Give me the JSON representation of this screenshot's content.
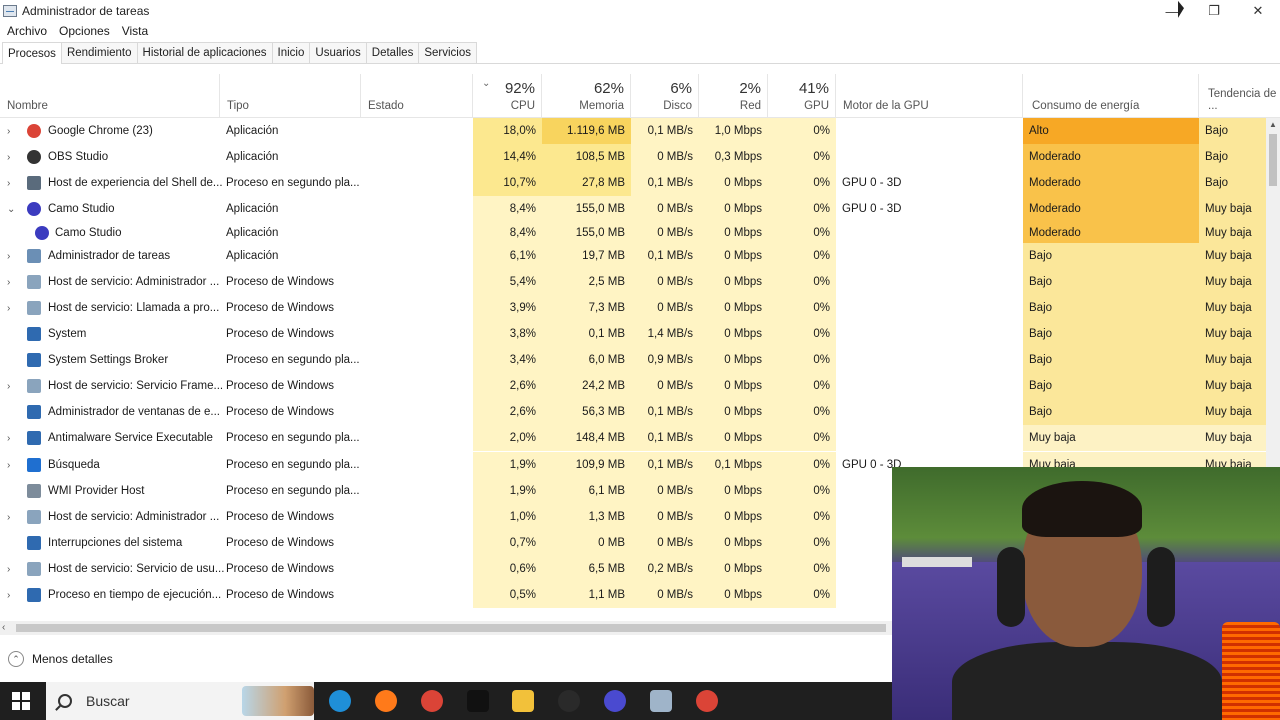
{
  "window": {
    "title": "Administrador de tareas",
    "minimize": "—",
    "restore": "❐",
    "close": "✕"
  },
  "menu": [
    "Archivo",
    "Opciones",
    "Vista"
  ],
  "tabs": [
    "Procesos",
    "Rendimiento",
    "Historial de aplicaciones",
    "Inicio",
    "Usuarios",
    "Detalles",
    "Servicios"
  ],
  "active_tab": "Procesos",
  "header": {
    "nombre": "Nombre",
    "tipo": "Tipo",
    "estado": "Estado",
    "cpu_pct": "92%",
    "cpu": "CPU",
    "mem_pct": "62%",
    "mem": "Memoria",
    "disk_pct": "6%",
    "disk": "Disco",
    "net_pct": "2%",
    "net": "Red",
    "gpu_pct": "41%",
    "gpu": "GPU",
    "gpu_engine": "Motor de la GPU",
    "power": "Consumo de energía",
    "power_trend": "Tendencia de ..."
  },
  "rows": [
    {
      "name": "Google Chrome (23)",
      "type": "Aplicación",
      "cpu": "18,0%",
      "mem": "1.119,6 MB",
      "disk": "0,1 MB/s",
      "net": "1,0 Mbps",
      "gpu": "0%",
      "engine": "",
      "power": "Alto",
      "trend": "Bajo",
      "exp": "›",
      "icon": "chrome-icon",
      "ic": "#db4437",
      "indent": 0,
      "pw": "#f7a825",
      "memhi": true,
      "cpuhi": true
    },
    {
      "name": "OBS Studio",
      "type": "Aplicación",
      "cpu": "14,4%",
      "mem": "108,5 MB",
      "disk": "0 MB/s",
      "net": "0,3 Mbps",
      "gpu": "0%",
      "engine": "",
      "power": "Moderado",
      "trend": "Bajo",
      "exp": "›",
      "icon": "obs-icon",
      "ic": "#333",
      "indent": 0,
      "pw": "#f9c24a",
      "memhi": false,
      "cpuhi": true
    },
    {
      "name": "Host de experiencia del Shell de...",
      "type": "Proceso en segundo pla...",
      "cpu": "10,7%",
      "mem": "27,8 MB",
      "disk": "0,1 MB/s",
      "net": "0 Mbps",
      "gpu": "0%",
      "engine": "GPU 0 - 3D",
      "power": "Moderado",
      "trend": "Bajo",
      "exp": "›",
      "icon": "window-icon",
      "ic": "#5a6b7c",
      "indent": 0,
      "pw": "#f9c24a",
      "memhi": false,
      "cpuhi": true
    },
    {
      "name": "Camo Studio",
      "type": "Aplicación",
      "cpu": "8,4%",
      "mem": "155,0 MB",
      "disk": "0 MB/s",
      "net": "0 Mbps",
      "gpu": "0%",
      "engine": "GPU 0 - 3D",
      "power": "Moderado",
      "trend": "Muy baja",
      "exp": "⌄",
      "icon": "camo-icon",
      "ic": "#3b3bbf",
      "indent": 0,
      "pw": "#f9c24a",
      "memhi": false,
      "cpuhi": false
    },
    {
      "name": "Camo Studio",
      "type": "Aplicación",
      "cpu": "8,4%",
      "mem": "155,0 MB",
      "disk": "0 MB/s",
      "net": "0 Mbps",
      "gpu": "0%",
      "engine": "",
      "power": "Moderado",
      "trend": "Muy baja",
      "exp": "",
      "icon": "camo-icon",
      "ic": "#3b3bbf",
      "indent": 1,
      "pw": "#f9c24a",
      "memhi": false,
      "cpuhi": false
    },
    {
      "name": "Administrador de tareas",
      "type": "Aplicación",
      "cpu": "6,1%",
      "mem": "19,7 MB",
      "disk": "0,1 MB/s",
      "net": "0 Mbps",
      "gpu": "0%",
      "engine": "",
      "power": "Bajo",
      "trend": "Muy baja",
      "exp": "›",
      "icon": "task-manager-icon",
      "ic": "#6b8fb5",
      "indent": 0,
      "pw": "#fbe79a",
      "memhi": false,
      "cpuhi": false
    },
    {
      "name": "Host de servicio: Administrador ...",
      "type": "Proceso de Windows",
      "cpu": "5,4%",
      "mem": "2,5 MB",
      "disk": "0 MB/s",
      "net": "0 Mbps",
      "gpu": "0%",
      "engine": "",
      "power": "Bajo",
      "trend": "Muy baja",
      "exp": "›",
      "icon": "gear-icon",
      "ic": "#8aa4bd",
      "indent": 0,
      "pw": "#fbe79a",
      "memhi": false,
      "cpuhi": false
    },
    {
      "name": "Host de servicio: Llamada a pro...",
      "type": "Proceso de Windows",
      "cpu": "3,9%",
      "mem": "7,3 MB",
      "disk": "0 MB/s",
      "net": "0 Mbps",
      "gpu": "0%",
      "engine": "",
      "power": "Bajo",
      "trend": "Muy baja",
      "exp": "›",
      "icon": "gear-icon",
      "ic": "#8aa4bd",
      "indent": 0,
      "pw": "#fbe79a",
      "memhi": false,
      "cpuhi": false
    },
    {
      "name": "System",
      "type": "Proceso de Windows",
      "cpu": "3,8%",
      "mem": "0,1 MB",
      "disk": "1,4 MB/s",
      "net": "0 Mbps",
      "gpu": "0%",
      "engine": "",
      "power": "Bajo",
      "trend": "Muy baja",
      "exp": "",
      "icon": "window-icon",
      "ic": "#2f6ab0",
      "indent": 0,
      "pw": "#fbe79a",
      "memhi": false,
      "cpuhi": false
    },
    {
      "name": "System Settings Broker",
      "type": "Proceso en segundo pla...",
      "cpu": "3,4%",
      "mem": "6,0 MB",
      "disk": "0,9 MB/s",
      "net": "0 Mbps",
      "gpu": "0%",
      "engine": "",
      "power": "Bajo",
      "trend": "Muy baja",
      "exp": "",
      "icon": "settings-icon",
      "ic": "#2f6ab0",
      "indent": 0,
      "pw": "#fbe79a",
      "memhi": false,
      "cpuhi": false
    },
    {
      "name": "Host de servicio: Servicio Frame...",
      "type": "Proceso de Windows",
      "cpu": "2,6%",
      "mem": "24,2 MB",
      "disk": "0 MB/s",
      "net": "0 Mbps",
      "gpu": "0%",
      "engine": "",
      "power": "Bajo",
      "trend": "Muy baja",
      "exp": "›",
      "icon": "gear-icon",
      "ic": "#8aa4bd",
      "indent": 0,
      "pw": "#fbe79a",
      "memhi": false,
      "cpuhi": false
    },
    {
      "name": "Administrador de ventanas de e...",
      "type": "Proceso de Windows",
      "cpu": "2,6%",
      "mem": "56,3 MB",
      "disk": "0,1 MB/s",
      "net": "0 Mbps",
      "gpu": "0%",
      "engine": "",
      "power": "Bajo",
      "trend": "Muy baja",
      "exp": "",
      "icon": "window-icon",
      "ic": "#2f6ab0",
      "indent": 0,
      "pw": "#fbe79a",
      "memhi": false,
      "cpuhi": false
    },
    {
      "name": "Antimalware Service Executable",
      "type": "Proceso en segundo pla...",
      "cpu": "2,0%",
      "mem": "148,4 MB",
      "disk": "0,1 MB/s",
      "net": "0 Mbps",
      "gpu": "0%",
      "engine": "",
      "power": "Muy baja",
      "trend": "Muy baja",
      "exp": "›",
      "icon": "window-icon",
      "ic": "#2f6ab0",
      "indent": 0,
      "pw": "#fdf2c4",
      "memhi": false,
      "cpuhi": false
    },
    {
      "name": "Búsqueda",
      "type": "Proceso en segundo pla...",
      "cpu": "1,9%",
      "mem": "109,9 MB",
      "disk": "0,1 MB/s",
      "net": "0,1 Mbps",
      "gpu": "0%",
      "engine": "GPU 0 - 3D",
      "power": "Muy baja",
      "trend": "Muy baja",
      "exp": "›",
      "icon": "search-icon",
      "ic": "#1f6fd0",
      "indent": 0,
      "pw": "#fdf2c4",
      "memhi": false,
      "cpuhi": false
    },
    {
      "name": "WMI Provider Host",
      "type": "Proceso en segundo pla...",
      "cpu": "1,9%",
      "mem": "6,1 MB",
      "disk": "0 MB/s",
      "net": "0 Mbps",
      "gpu": "0%",
      "engine": "",
      "power": "",
      "trend": "",
      "exp": "",
      "icon": "wmi-icon",
      "ic": "#7d8c9b",
      "indent": 0,
      "pw": "#fdf2c4",
      "memhi": false,
      "cpuhi": false
    },
    {
      "name": "Host de servicio: Administrador ...",
      "type": "Proceso de Windows",
      "cpu": "1,0%",
      "mem": "1,3 MB",
      "disk": "0 MB/s",
      "net": "0 Mbps",
      "gpu": "0%",
      "engine": "",
      "power": "",
      "trend": "",
      "exp": "›",
      "icon": "gear-icon",
      "ic": "#8aa4bd",
      "indent": 0,
      "pw": "#fdf2c4",
      "memhi": false,
      "cpuhi": false
    },
    {
      "name": "Interrupciones del sistema",
      "type": "Proceso de Windows",
      "cpu": "0,7%",
      "mem": "0 MB",
      "disk": "0 MB/s",
      "net": "0 Mbps",
      "gpu": "0%",
      "engine": "",
      "power": "",
      "trend": "",
      "exp": "",
      "icon": "window-icon",
      "ic": "#2f6ab0",
      "indent": 0,
      "pw": "#fdf2c4",
      "memhi": false,
      "cpuhi": false
    },
    {
      "name": "Host de servicio: Servicio de usu...",
      "type": "Proceso de Windows",
      "cpu": "0,6%",
      "mem": "6,5 MB",
      "disk": "0,2 MB/s",
      "net": "0 Mbps",
      "gpu": "0%",
      "engine": "",
      "power": "",
      "trend": "",
      "exp": "›",
      "icon": "gear-icon",
      "ic": "#8aa4bd",
      "indent": 0,
      "pw": "#fdf2c4",
      "memhi": false,
      "cpuhi": false
    },
    {
      "name": "Proceso en tiempo de ejecución...",
      "type": "Proceso de Windows",
      "cpu": "0,5%",
      "mem": "1,1 MB",
      "disk": "0 MB/s",
      "net": "0 Mbps",
      "gpu": "0%",
      "engine": "",
      "power": "",
      "trend": "",
      "exp": "›",
      "icon": "window-icon",
      "ic": "#2f6ab0",
      "indent": 0,
      "pw": "#fdf2c4",
      "memhi": false,
      "cpuhi": false
    }
  ],
  "footer": {
    "less_details": "Menos detalles"
  },
  "taskbar": {
    "search_placeholder": "Buscar",
    "apps": [
      {
        "name": "edge-icon",
        "color": "#1f8fd8"
      },
      {
        "name": "firefox-icon",
        "color": "#ff7a1a"
      },
      {
        "name": "chrome-icon",
        "color": "#db4437"
      },
      {
        "name": "tiktok-icon",
        "color": "#111111"
      },
      {
        "name": "file-explorer-icon",
        "color": "#f2c13a"
      },
      {
        "name": "obs-icon",
        "color": "#2a2a2a"
      },
      {
        "name": "camo-icon",
        "color": "#4a4ad0"
      },
      {
        "name": "task-manager-icon",
        "color": "#9fb4c9"
      },
      {
        "name": "chrome-icon",
        "color": "#db4437"
      }
    ]
  },
  "colors": {
    "cpu_high": "#fce88f",
    "cell_base": "#fff4c4",
    "mem_high": "#f8d45e",
    "power_high": "#f7a825"
  }
}
